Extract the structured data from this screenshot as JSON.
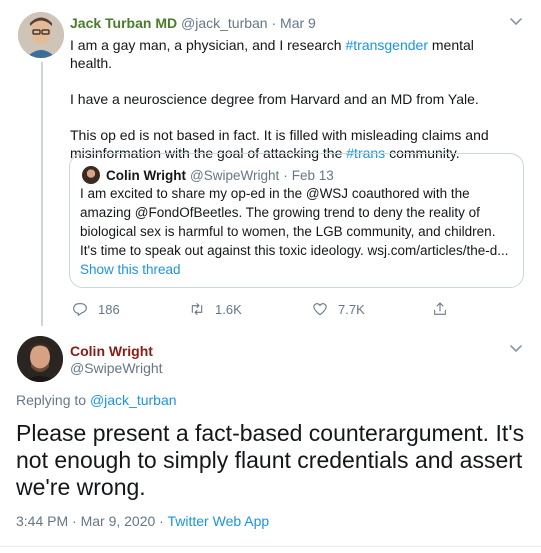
{
  "tweet": {
    "author_name": "Jack Turban MD",
    "author_handle": "@jack_turban",
    "separator": "·",
    "date": "Mar 9",
    "body": {
      "p1_before": "I am a gay man, a physician, and I research ",
      "p1_tag": "#transgender",
      "p1_after": " mental health.",
      "p2": "I have a neuroscience degree from Harvard and an MD from Yale.",
      "p3_before": "This op ed is not based in fact. It is filled with misleading claims and misinformation with the goal of attacking the ",
      "p3_tag": "#trans",
      "p3_after": " community."
    },
    "quote": {
      "author_name": "Colin Wright",
      "author_handle": "@SwipeWright",
      "separator": "·",
      "date": "Feb 13",
      "text": "I am excited to share my op-ed in the @WSJ coauthored with the amazing @FondOfBeetles. The growing trend to deny the reality of biological sex is harmful to women, the LGB community, and children. It's time to speak out against this toxic ideology. wsj.com/articles/the-d...",
      "show_thread": "Show this thread"
    },
    "actions": {
      "replies": "186",
      "retweets": "1.6K",
      "likes": "7.7K"
    }
  },
  "reply": {
    "author_name": "Colin Wright",
    "author_handle": "@SwipeWright",
    "replying_prefix": "Replying to ",
    "replying_to": "@jack_turban",
    "text": "Please present a fact-based counterargument. It's not enough to simply flaunt credentials and assert we're wrong.",
    "timestamp": "3:44 PM · Mar 9, 2020 · ",
    "source": "Twitter Web App"
  },
  "icons": [
    "reply-icon",
    "retweet-icon",
    "like-icon",
    "share-icon",
    "chevron-down-icon"
  ],
  "colors": {
    "link": "#1b95e0",
    "muted": "#657786",
    "jack_name": "#4a7c2c",
    "colin_name": "#8a1c14",
    "border": "#ccd6dd"
  }
}
